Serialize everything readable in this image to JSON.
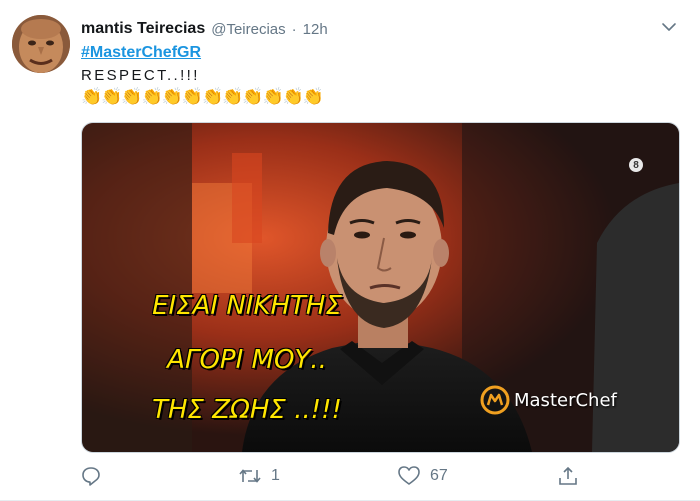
{
  "tweet": {
    "author_name": "mantis Teirecias",
    "handle": "@Teirecias",
    "separator": "·",
    "time": "12h",
    "hashtag": "#MasterChefGR",
    "text_line": "RESPECT..!!!",
    "claps": "👏👏👏👏👏👏👏👏👏👏👏👏",
    "avatar_icon": "avatar-face"
  },
  "media": {
    "meme_lines": [
      "ΕΙΣΑΙ ΝΙΚΗΤΗΣ",
      "ΑΓΟΡΙ ΜΟΥ..",
      "ΤΗΣ ΖΩΗΣ ..!!!"
    ],
    "logo_text": "MasterChef",
    "rating_badge": "8",
    "meme_text_color": "#ffe600"
  },
  "actions": {
    "reply_icon": "reply-icon",
    "retweet_icon": "retweet-icon",
    "retweet_count": "1",
    "like_icon": "heart-icon",
    "like_count": "67",
    "share_icon": "share-icon"
  },
  "colors": {
    "link": "#1b95e0",
    "muted": "#657786",
    "text": "#14171a"
  }
}
